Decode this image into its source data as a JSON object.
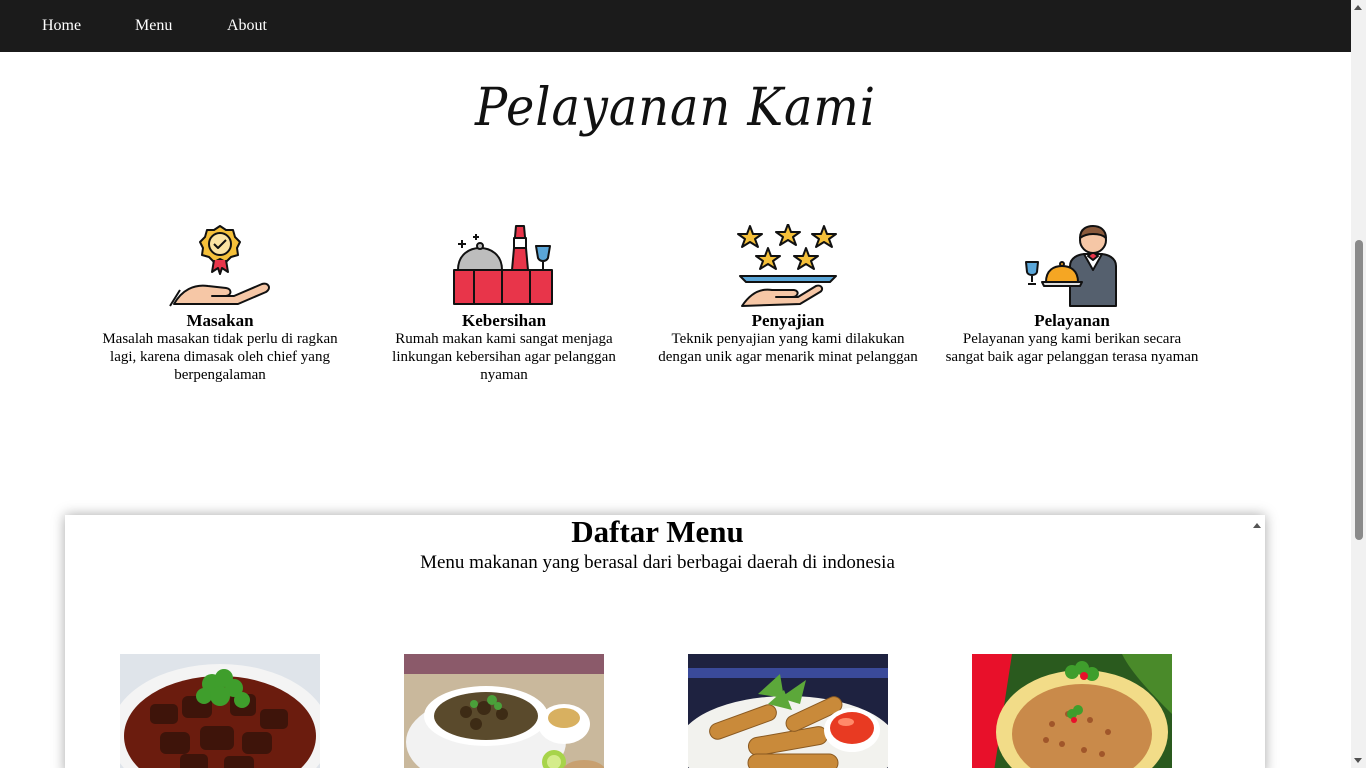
{
  "nav": {
    "items": [
      {
        "label": "Home"
      },
      {
        "label": "Menu"
      },
      {
        "label": "About"
      }
    ]
  },
  "services": {
    "title": "Pelayanan Kami",
    "items": [
      {
        "title": "Masakan",
        "description": "Masalah masakan tidak perlu di ragkan lagi, karena dimasak oleh chief yang berpengalaman",
        "icon": "award-hand-icon"
      },
      {
        "title": "Kebersihan",
        "description": "Rumah makan kami sangat menjaga linkungan kebersihan agar pelanggan nyaman",
        "icon": "dining-table-icon"
      },
      {
        "title": "Penyajian",
        "description": "Teknik penyajian yang kami dilakukan dengan unik agar menarik minat pelanggan",
        "icon": "stars-tray-icon"
      },
      {
        "title": "Pelayanan",
        "description": "Pelayanan yang kami berikan secara sangat baik agar pelanggan terasa nyaman",
        "icon": "waiter-icon"
      }
    ]
  },
  "menu": {
    "title": "Daftar Menu",
    "subtitle": "Menu makanan yang berasal dari berbagai daerah di indonesia"
  },
  "colors": {
    "navbar": "#1b1b1b",
    "nav_text": "#ffffff",
    "icon_red": "#e8354a",
    "icon_gold": "#f5c03a",
    "icon_blue": "#5aa6d8"
  }
}
